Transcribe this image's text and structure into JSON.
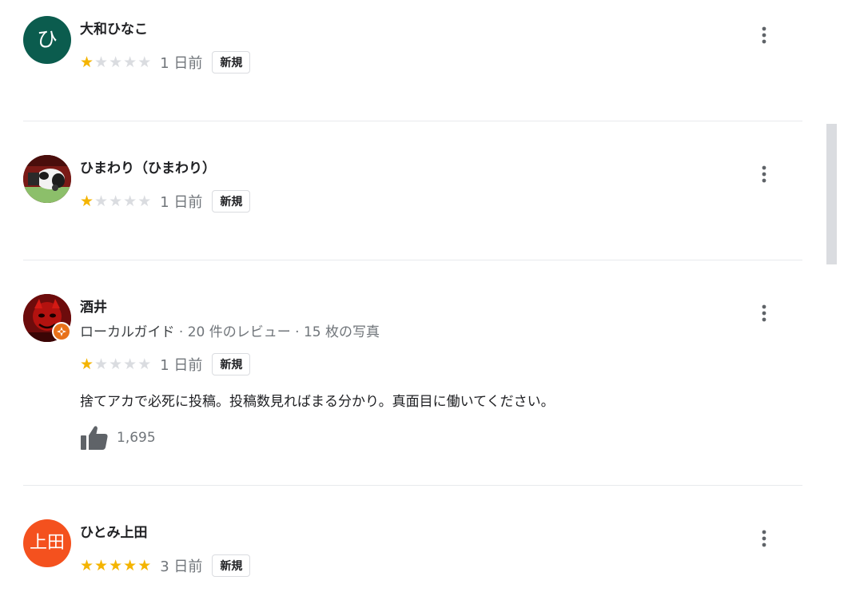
{
  "reviews": [
    {
      "name": "大和ひなこ",
      "avatar_initial": "ひ",
      "avatar_color": "#0b5c4e",
      "rating": 1,
      "max_rating": 5,
      "time": "1 日前",
      "badge": "新規"
    },
    {
      "name": "ひまわり（ひまわり）",
      "avatar_kind": "photo",
      "rating": 1,
      "max_rating": 5,
      "time": "1 日前",
      "badge": "新規"
    },
    {
      "name": "酒井",
      "avatar_kind": "photo",
      "local_guide": "ローカルガイド",
      "guide_stats": "· 20 件のレビュー · 15 枚の写真",
      "rating": 1,
      "max_rating": 5,
      "time": "1 日前",
      "badge": "新規",
      "text": "捨てアカで必死に投稿。投稿数見ればまる分かり。真面目に働いてください。",
      "likes": "1,695"
    },
    {
      "name": "ひとみ上田",
      "avatar_initial": "上田",
      "avatar_color": "#f4511e",
      "rating": 5,
      "max_rating": 5,
      "time": "3 日前",
      "badge": "新規"
    }
  ],
  "colors": {
    "star_filled": "#f4b400",
    "star_empty": "#dadce0",
    "local_guide_badge": "#e8711a"
  },
  "icons": {
    "more": "more-vert-icon",
    "like": "thumb-up-icon",
    "guide": "local-guide-badge-icon"
  }
}
